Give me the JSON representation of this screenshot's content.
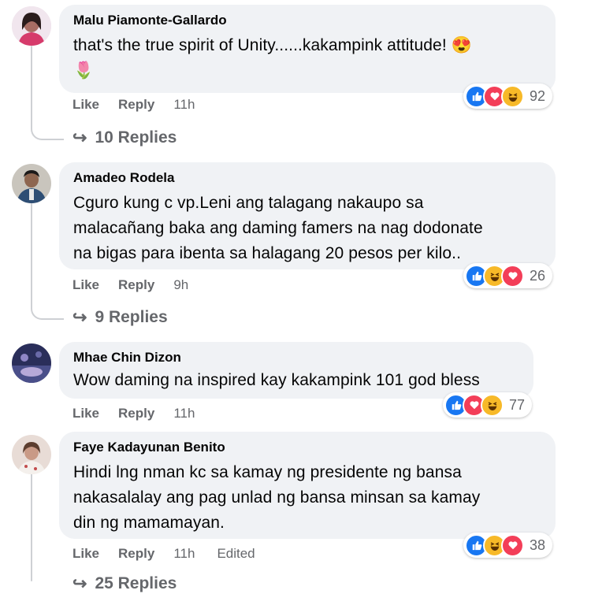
{
  "comments": [
    {
      "author": "Malu Piamonte-Gallardo",
      "text": "that's the true spirit of Unity......kakampink attitude! 😍",
      "text2": "🌷",
      "like_label": "Like",
      "reply_label": "Reply",
      "time": "11h",
      "reaction_count": "92",
      "reactions": [
        "like-icon",
        "love-icon",
        "haha-icon"
      ],
      "replies_label": "10 Replies"
    },
    {
      "author": "Amadeo Rodela",
      "lines": [
        "Cguro kung c vp.Leni ang talagang nakaupo sa",
        "malacañang baka ang daming famers na nag dodonate",
        "na bigas para ibenta sa halagang 20 pesos per kilo.."
      ],
      "like_label": "Like",
      "reply_label": "Reply",
      "time": "9h",
      "reaction_count": "26",
      "reactions": [
        "like-icon",
        "haha-icon",
        "love-icon"
      ],
      "replies_label": "9 Replies"
    },
    {
      "author": "Mhae Chin Dizon",
      "text": "Wow daming na inspired kay kakampink 101 god bless",
      "like_label": "Like",
      "reply_label": "Reply",
      "time": "11h",
      "reaction_count": "77",
      "reactions": [
        "like-icon",
        "love-icon",
        "haha-icon"
      ]
    },
    {
      "author": "Faye Kadayunan Benito",
      "lines": [
        "Hindi lng nman kc sa kamay ng presidente ng bansa",
        "nakasalalay ang pag unlad ng bansa minsan sa kamay",
        "din ng mamamayan."
      ],
      "like_label": "Like",
      "reply_label": "Reply",
      "time": "11h",
      "edited_label": "Edited",
      "reaction_count": "38",
      "reactions": [
        "like-icon",
        "haha-icon",
        "love-icon"
      ],
      "replies_label": "25 Replies"
    }
  ],
  "colors": {
    "bubble": "#f0f2f5",
    "secondary_text": "#65676b",
    "like": "#1877f2",
    "love": "#f33e58",
    "haha": "#f7b928"
  }
}
